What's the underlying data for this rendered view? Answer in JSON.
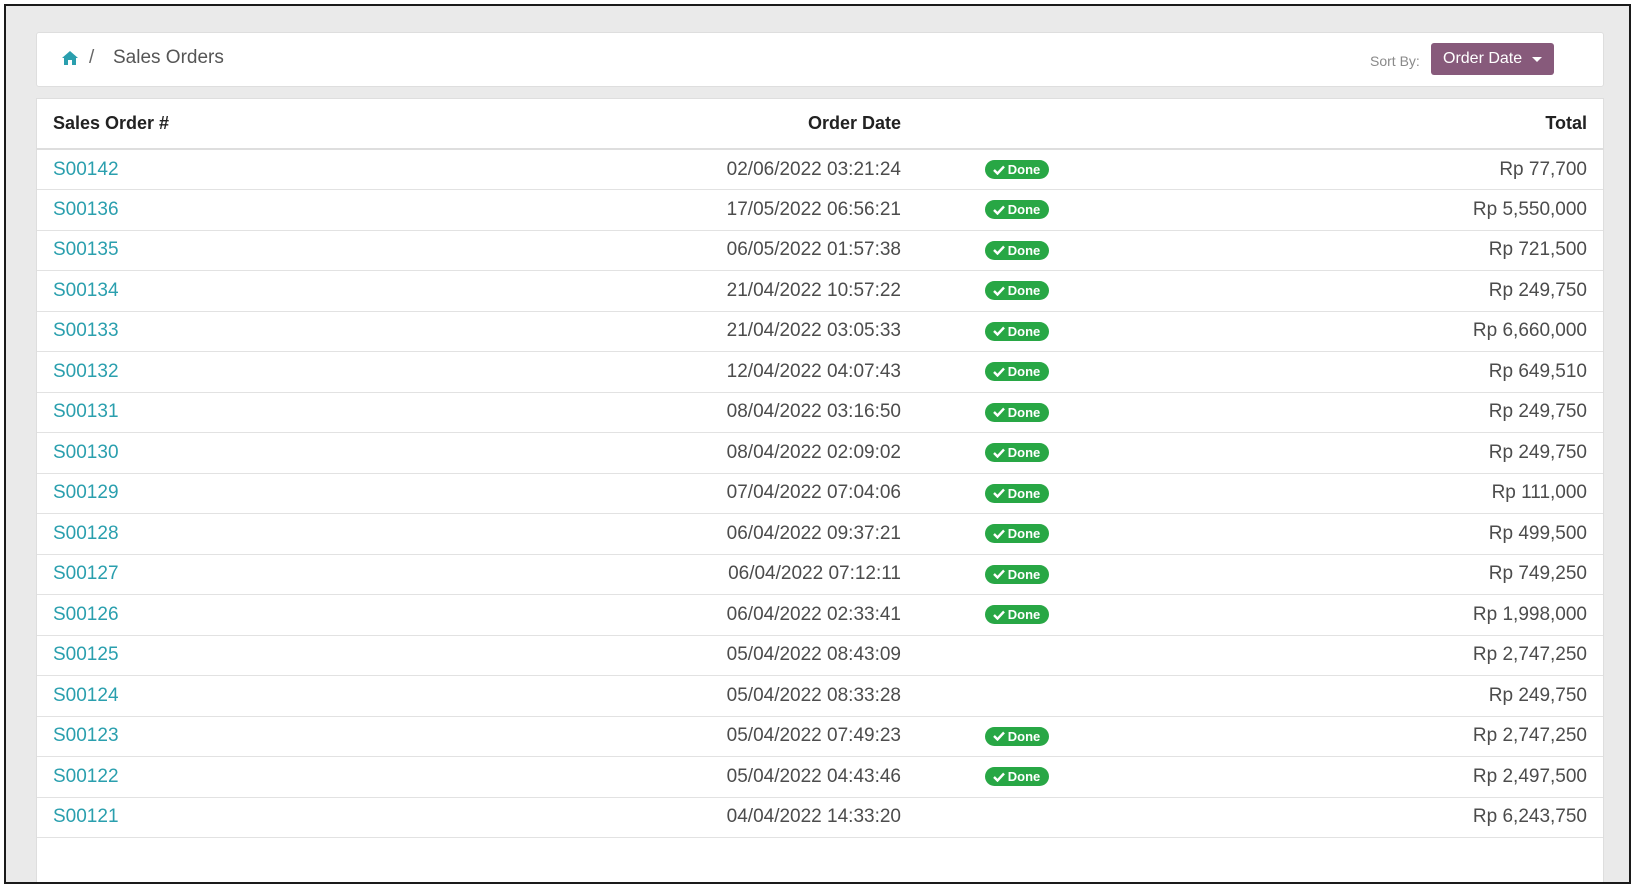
{
  "breadcrumb": {
    "separator": "/",
    "current": "Sales Orders"
  },
  "sort": {
    "label": "Sort By:",
    "value": "Order Date"
  },
  "table": {
    "headers": {
      "order": "Sales Order #",
      "date": "Order Date",
      "status": "",
      "total": "Total"
    },
    "rows": [
      {
        "order": "S00142",
        "date": "02/06/2022  03:21:24",
        "status": "Done",
        "total": "Rp 77,700"
      },
      {
        "order": "S00136",
        "date": "17/05/2022  06:56:21",
        "status": "Done",
        "total": "Rp 5,550,000"
      },
      {
        "order": "S00135",
        "date": "06/05/2022  01:57:38",
        "status": "Done",
        "total": "Rp 721,500"
      },
      {
        "order": "S00134",
        "date": "21/04/2022  10:57:22",
        "status": "Done",
        "total": "Rp 249,750"
      },
      {
        "order": "S00133",
        "date": "21/04/2022  03:05:33",
        "status": "Done",
        "total": "Rp 6,660,000"
      },
      {
        "order": "S00132",
        "date": "12/04/2022  04:07:43",
        "status": "Done",
        "total": "Rp 649,510"
      },
      {
        "order": "S00131",
        "date": "08/04/2022  03:16:50",
        "status": "Done",
        "total": "Rp 249,750"
      },
      {
        "order": "S00130",
        "date": "08/04/2022  02:09:02",
        "status": "Done",
        "total": "Rp 249,750"
      },
      {
        "order": "S00129",
        "date": "07/04/2022  07:04:06",
        "status": "Done",
        "total": "Rp 111,000"
      },
      {
        "order": "S00128",
        "date": "06/04/2022  09:37:21",
        "status": "Done",
        "total": "Rp 499,500"
      },
      {
        "order": "S00127",
        "date": "06/04/2022  07:12:11",
        "status": "Done",
        "total": "Rp 749,250"
      },
      {
        "order": "S00126",
        "date": "06/04/2022  02:33:41",
        "status": "Done",
        "total": "Rp 1,998,000"
      },
      {
        "order": "S00125",
        "date": "05/04/2022  08:43:09",
        "status": "",
        "total": "Rp 2,747,250"
      },
      {
        "order": "S00124",
        "date": "05/04/2022  08:33:28",
        "status": "",
        "total": "Rp 249,750"
      },
      {
        "order": "S00123",
        "date": "05/04/2022  07:49:23",
        "status": "Done",
        "total": "Rp 2,747,250"
      },
      {
        "order": "S00122",
        "date": "05/04/2022  04:43:46",
        "status": "Done",
        "total": "Rp 2,497,500"
      },
      {
        "order": "S00121",
        "date": "04/04/2022  14:33:20",
        "status": "",
        "total": "Rp 6,243,750"
      }
    ]
  },
  "colors": {
    "accent": "#875a7b",
    "link": "#2a9fae",
    "done": "#28a745"
  }
}
